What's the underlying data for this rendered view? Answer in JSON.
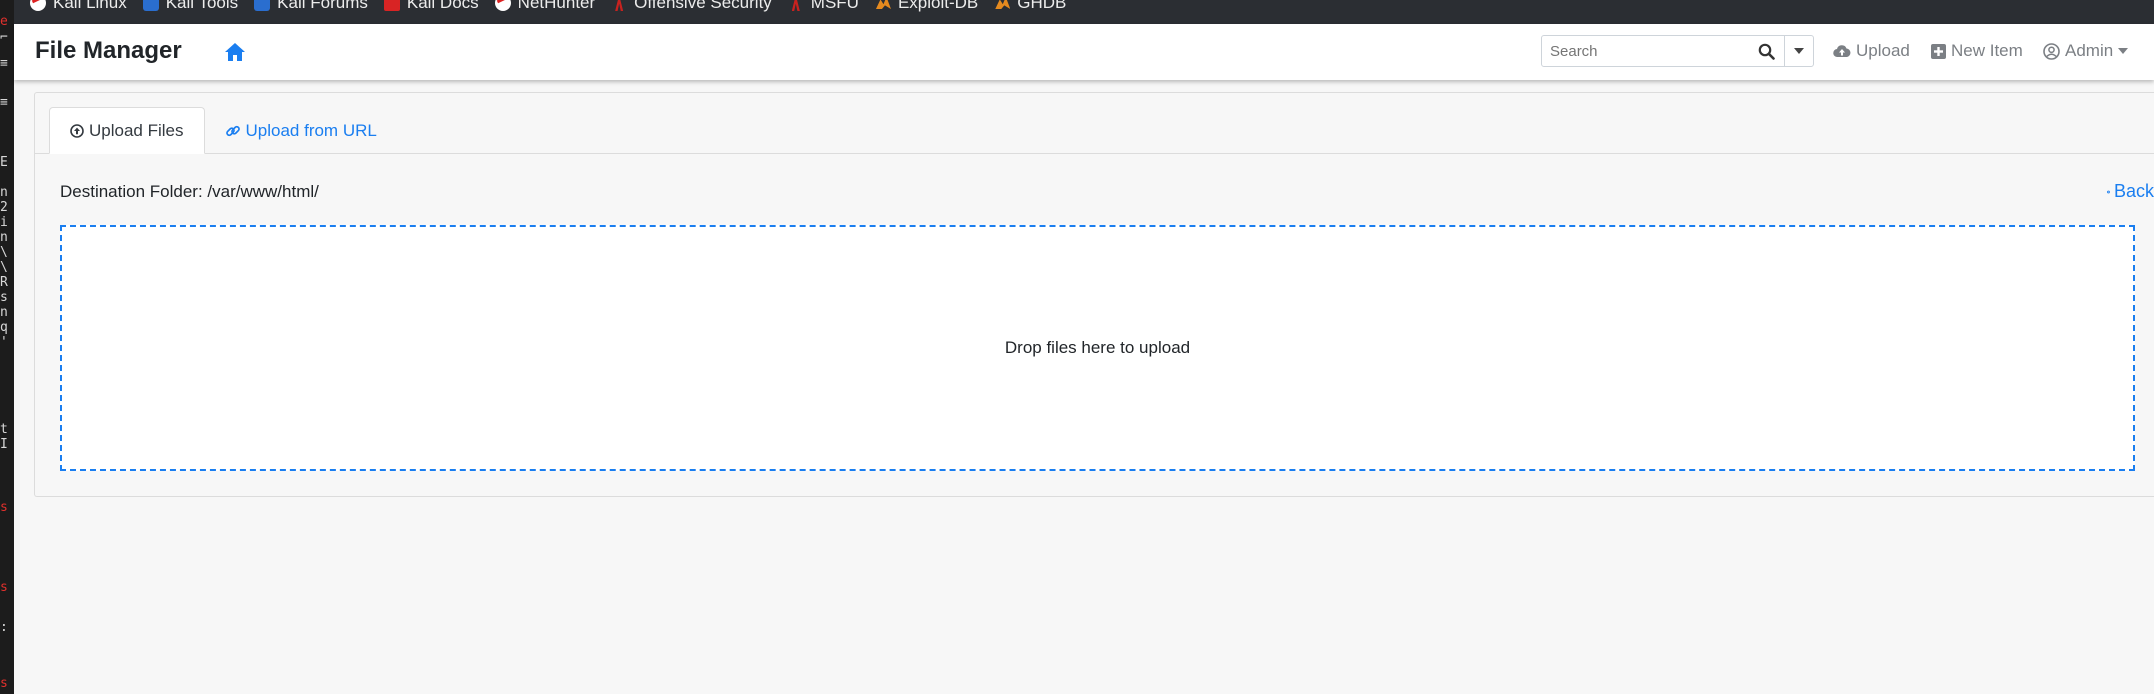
{
  "bookmarks": [
    {
      "label": "Kali Linux",
      "icon": "kali-dragon-icon"
    },
    {
      "label": "Kali Tools",
      "icon": "kali-tools-icon"
    },
    {
      "label": "Kali Forums",
      "icon": "kali-forums-icon"
    },
    {
      "label": "Kali Docs",
      "icon": "kali-docs-icon"
    },
    {
      "label": "NetHunter",
      "icon": "nethunter-icon"
    },
    {
      "label": "Offensive Security",
      "icon": "offsec-icon"
    },
    {
      "label": "MSFU",
      "icon": "msfu-icon"
    },
    {
      "label": "Exploit-DB",
      "icon": "exploit-db-icon"
    },
    {
      "label": "GHDB",
      "icon": "ghdb-icon"
    }
  ],
  "navbar": {
    "title": "File Manager",
    "search_placeholder": "Search",
    "upload_label": "Upload",
    "new_item_label": "New Item",
    "admin_label": "Admin"
  },
  "tabs": [
    {
      "label": "Upload Files",
      "active": true
    },
    {
      "label": "Upload from URL",
      "active": false
    }
  ],
  "main": {
    "destination_label": "Destination Folder: /var/www/html/",
    "back_label": "Back",
    "dropzone_text": "Drop files here to upload"
  },
  "colors": {
    "accent": "#1a7ef0",
    "bookmarks_bg": "#2b2e33",
    "page_bg": "#f7f7f7"
  }
}
